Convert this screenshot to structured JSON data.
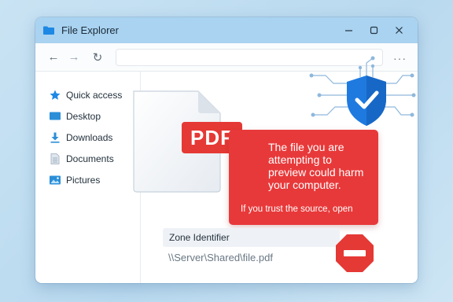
{
  "window": {
    "title": "File Explorer",
    "controls": {
      "minimize": "—",
      "maximize": "☐",
      "close": "✕"
    }
  },
  "toolbar": {
    "back_icon": "←",
    "forward_icon": "→",
    "refresh_icon": "↻",
    "address_value": "",
    "more_icon": "···"
  },
  "sidebar": {
    "items": [
      {
        "label": "Quick access",
        "icon": "star-icon"
      },
      {
        "label": "Desktop",
        "icon": "desktop-icon"
      },
      {
        "label": "Downloads",
        "icon": "download-icon"
      },
      {
        "label": "Documents",
        "icon": "document-icon"
      },
      {
        "label": "Pictures",
        "icon": "picture-icon"
      }
    ]
  },
  "preview": {
    "file_badge": "PDF",
    "warning_main": "The file you are attempting to preview could harm your computer.",
    "warning_sub": "If you trust the source, open",
    "zone_label": "Zone Identifier",
    "file_path": "\\\\Server\\Shared\\file.pdf"
  },
  "colors": {
    "titlebar": "#a9d3f0",
    "warning_red": "#e8393a",
    "shield_blue": "#1f7ae0",
    "folder_blue": "#1e88e5"
  }
}
